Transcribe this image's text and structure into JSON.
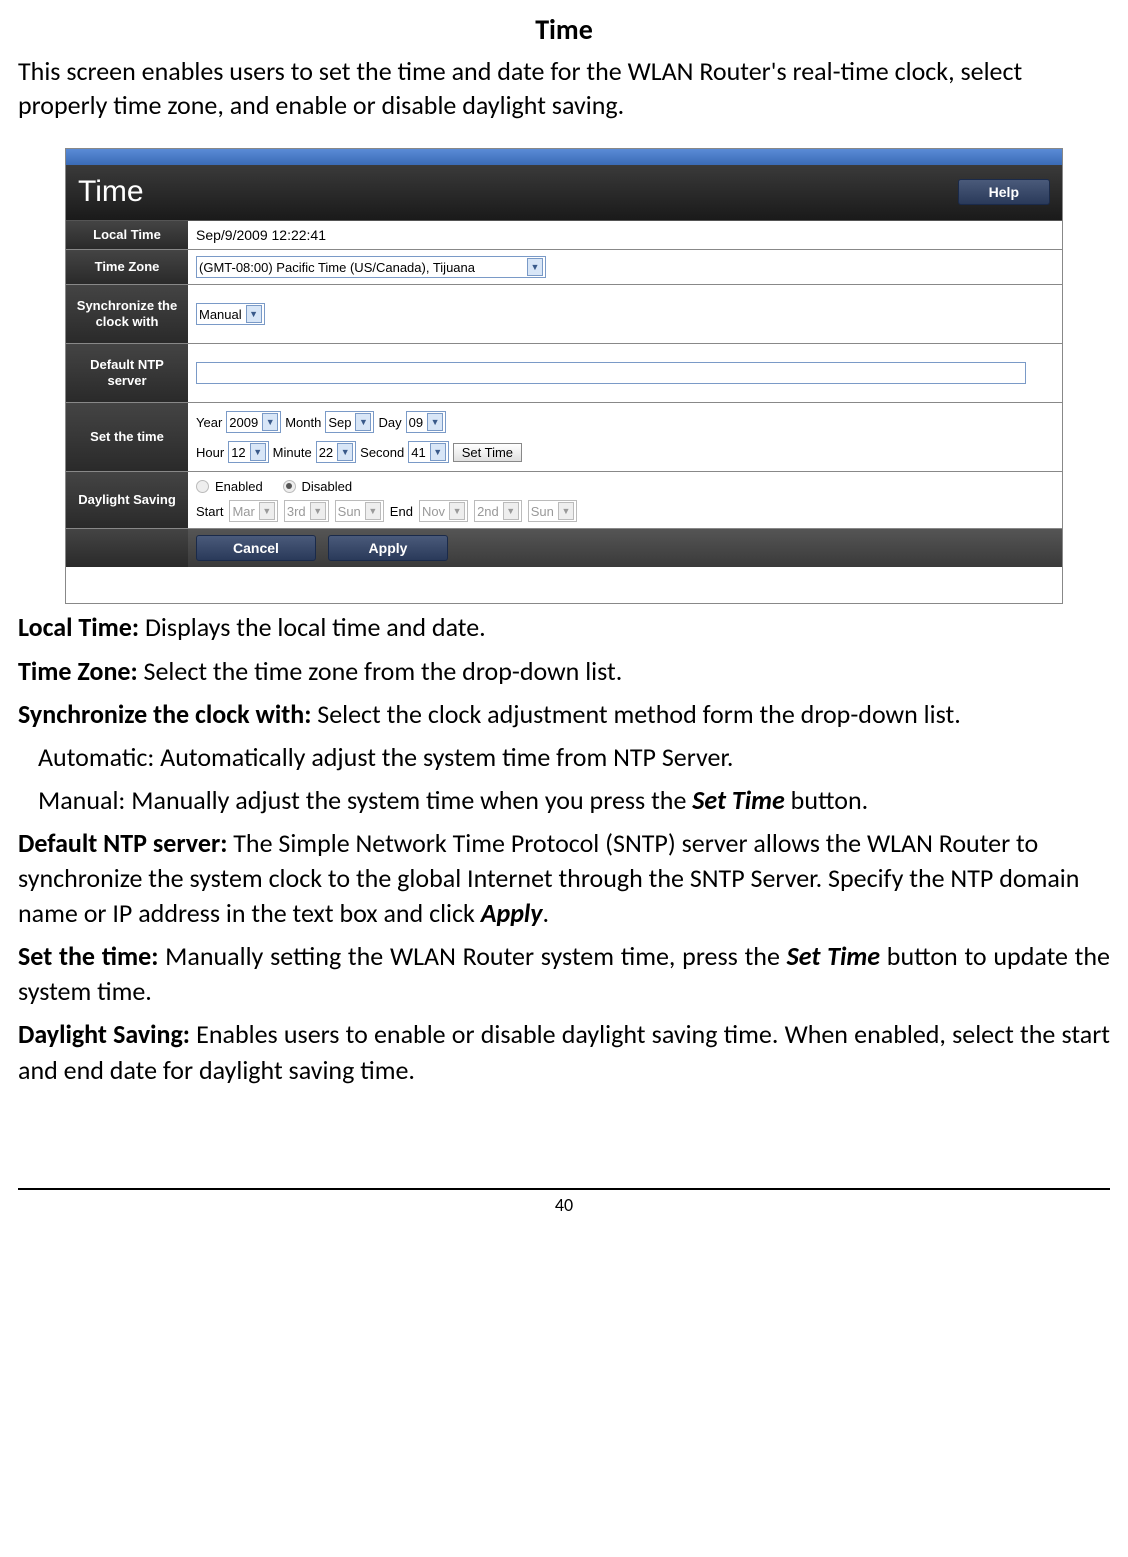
{
  "doc": {
    "title": "Time",
    "intro": "This screen enables users to set the time and date for the WLAN Router's real-time clock, select properly time zone, and enable or disable daylight saving.",
    "page_number": "40"
  },
  "scr": {
    "header_title": "Time",
    "help_label": "Help",
    "rows": {
      "local_time_label": "Local Time",
      "local_time_value": "Sep/9/2009 12:22:41",
      "time_zone_label": "Time Zone",
      "time_zone_value": "(GMT-08:00) Pacific Time (US/Canada), Tijuana",
      "sync_label": "Synchronize the clock with",
      "sync_value": "Manual",
      "ntp_label": "Default NTP server",
      "ntp_value": "",
      "set_time_label": "Set the time",
      "year_label": "Year",
      "year_value": "2009",
      "month_label": "Month",
      "month_value": "Sep",
      "day_label": "Day",
      "day_value": "09",
      "hour_label": "Hour",
      "hour_value": "12",
      "minute_label": "Minute",
      "minute_value": "22",
      "second_label": "Second",
      "second_value": "41",
      "set_time_btn": "Set Time",
      "daylight_label": "Daylight Saving",
      "enabled_label": "Enabled",
      "disabled_label": "Disabled",
      "start_label": "Start",
      "end_label": "End",
      "dl_start_month": "Mar",
      "dl_start_week": "3rd",
      "dl_start_day": "Sun",
      "dl_end_month": "Nov",
      "dl_end_week": "2nd",
      "dl_end_day": "Sun"
    },
    "footer": {
      "cancel": "Cancel",
      "apply": "Apply"
    }
  },
  "desc": {
    "local_time_b": "Local Time:",
    "local_time_t": " Displays the local time and date.",
    "time_zone_b": "Time Zone:",
    "time_zone_t": " Select the time zone from the drop-down list.",
    "sync_b": "Synchronize the clock with:",
    "sync_t": " Select the clock adjustment method form the drop-down list.",
    "auto": "Automatic: Automatically adjust the system time from NTP Server.",
    "manual_pre": "Manual: Manually adjust the system time when you press the ",
    "manual_set_time": "Set Time",
    "manual_post": " button.",
    "ntp_b": "Default NTP server:",
    "ntp_t": " The Simple Network Time Protocol (SNTP) server allows the WLAN Router to synchronize the system clock to the global Internet through the SNTP Server. Specify the NTP domain name or IP address in the text box and click ",
    "ntp_apply": "Apply",
    "ntp_end": ".",
    "settime_b": "Set the time:",
    "settime_t": " Manually setting the WLAN Router system time, press the ",
    "settime_btn": "Set Time",
    "settime_post": " button to update the system time.",
    "daylight_b": "Daylight Saving:",
    "daylight_t": " Enables users to enable or disable daylight saving time. When enabled, select the start and end date for daylight saving time."
  }
}
